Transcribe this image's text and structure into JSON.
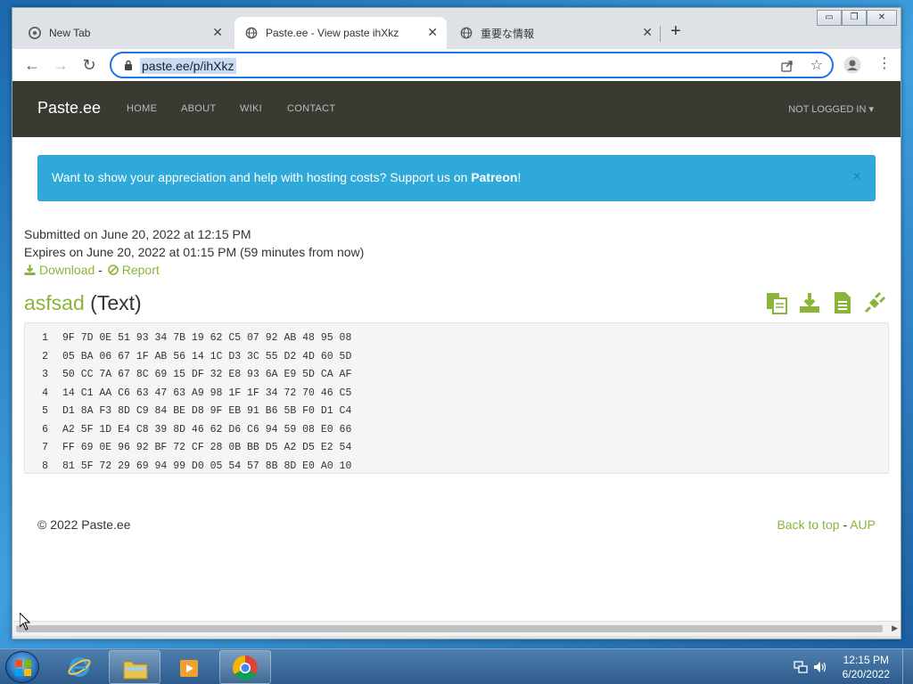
{
  "window": {
    "minimize": "▭",
    "maximize": "❐",
    "close": "✕"
  },
  "tabs": [
    {
      "title": "New Tab",
      "icon": "chrome-icon",
      "active": false
    },
    {
      "title": "Paste.ee - View paste ihXkz",
      "icon": "globe-icon",
      "active": true
    },
    {
      "title": "重要な情報",
      "icon": "globe-icon",
      "active": false
    }
  ],
  "toolbar": {
    "url": "paste.ee/p/ihXkz"
  },
  "site": {
    "brand": "Paste.ee",
    "nav": [
      "HOME",
      "ABOUT",
      "WIKI",
      "CONTACT"
    ],
    "user_menu": "NOT LOGGED IN"
  },
  "alert": {
    "text": "Want to show your appreciation and help with hosting costs? Support us on ",
    "link": "Patreon",
    "suffix": "!",
    "close": "×"
  },
  "paste": {
    "submitted": "Submitted on June 20, 2022 at 12:15 PM",
    "expires": "Expires on June 20, 2022 at 01:15 PM (59 minutes from now)",
    "download": "Download",
    "separator": "-",
    "report": "Report",
    "name": "asfsad",
    "type": "(Text)",
    "lines": [
      "9F 7D 0E 51 93 34 7B 19 62 C5 07 92 AB 48 95 08",
      "05 BA 06 67 1F AB 56 14 1C D3 3C 55 D2 4D 60 5D",
      "50 CC 7A 67 8C 69 15 DF 32 E8 93 6A E9 5D CA AF",
      "14 C1 AA C6 63 47 63 A9 98 1F 1F 34 72 70 46 C5",
      "D1 8A F3 8D C9 84 BE D8 9F EB 91 B6 5B F0 D1 C4",
      "A2 5F 1D E4 C8 39 8D 46 62 D6 C6 94 59 08 E0 66",
      "FF 69 0E 96 92 BF 72 CF 28 0B BB D5 A2 D5 E2 54",
      "81 5F 72 29 69 94 99 D0 05 54 57 8B 8D E0 A0 10"
    ],
    "line_numbers": [
      "1",
      "2",
      "3",
      "4",
      "5",
      "6",
      "7",
      "8"
    ]
  },
  "footer": {
    "copyright": "© 2022 Paste.ee",
    "back_to_top": "Back to top",
    "separator": "-",
    "aup": "AUP"
  },
  "taskbar": {
    "time": "12:15 PM",
    "date": "6/20/2022"
  },
  "colors": {
    "accent_green": "#8ab53a",
    "alert_blue": "#2fa9d9",
    "navbar": "#3a3a33"
  }
}
